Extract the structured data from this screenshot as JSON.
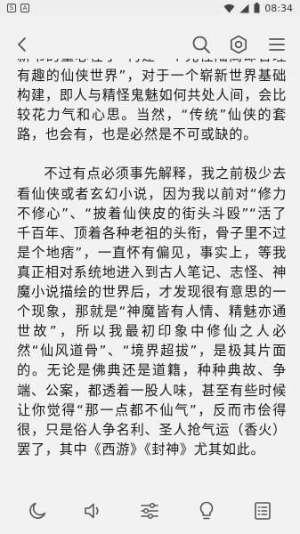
{
  "status_bar": {
    "time": "08:34",
    "left_icons": [
      "notification-s-icon",
      "notification-a-icon"
    ],
    "right_icons": [
      "wifi-icon",
      "signal-icon",
      "battery-icon"
    ]
  },
  "toolbar": {
    "icons": [
      "back-arrow-icon",
      "search-icon",
      "settings-hexagon-icon",
      "menu-icon"
    ]
  },
  "reader": {
    "paragraphs": [
      {
        "continued": true,
        "text": "新书的重心在于“构建一个光怪陆离却合理有趣的仙侠世界”，对于一个崭新世界基础构建，即人与精怪鬼魅如何共处人间，会比较花力气和心思。当然，“传统”仙侠的套路，也会有，也是必然是不可或缺的。"
      },
      {
        "continued": false,
        "text": "不过有点必须事先解释，我之前极少去看仙侠或者玄幻小说，因为我以前对“修力不修心”、“披着仙侠皮的街头斗殴”“活了千百年、顶着各种老祖的头衔，骨子里不过是个地痞”，一直怀有偏见，事实上，等我真正相对系统地进入到古人笔记、志怪、神魔小说描绘的世界后，才发现很有意思的一个现象，那就是“神魔皆有人情、精魅亦通世故”，所以我最初印象中修仙之人必然“仙风道骨”、“境界超拔”，是极其片面的。无论是佛典还是道籍，种种典故、争端、公案，都透着一股人味，甚至有些时候让你觉得“那一点都不仙气”，反而市侩得很，只是俗人争名利、圣人抢气运（香火）罢了，其中《西游》《封神》尤其如此。"
      }
    ]
  },
  "bottom_bar": {
    "icons": [
      "night-mode-moon-icon",
      "read-aloud-speaker-icon",
      "adjust-sliders-icon",
      "idea-bulb-icon",
      "table-of-contents-icon"
    ]
  }
}
